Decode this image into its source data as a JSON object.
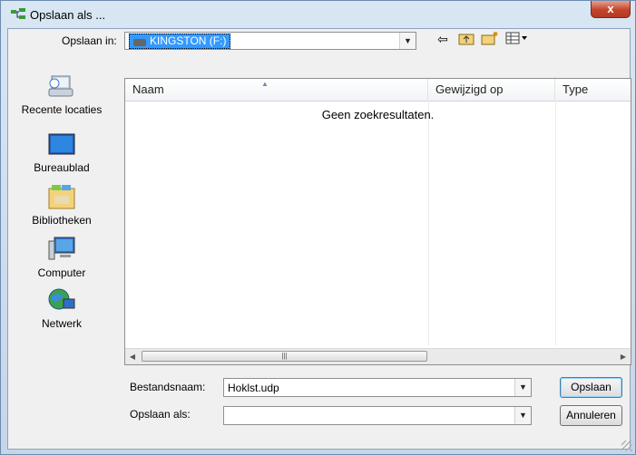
{
  "window": {
    "title": "Opslaan als ...",
    "close_glyph": "x"
  },
  "toolbar": {
    "save_in_label": "Opslaan in:",
    "location_value": "KINGSTON (F:)",
    "icons": [
      "back-icon",
      "up-folder-icon",
      "new-folder-icon",
      "view-menu-icon"
    ]
  },
  "places": [
    {
      "label": "Recente locaties",
      "icon": "recent-locations-icon"
    },
    {
      "label": "Bureaublad",
      "icon": "desktop-icon"
    },
    {
      "label": "Bibliotheken",
      "icon": "libraries-icon"
    },
    {
      "label": "Computer",
      "icon": "computer-icon"
    },
    {
      "label": "Netwerk",
      "icon": "network-icon"
    }
  ],
  "filelist": {
    "columns": [
      "Naam",
      "Gewijzigd op",
      "Type"
    ],
    "empty_message": "Geen zoekresultaten."
  },
  "form": {
    "filename_label": "Bestandsnaam:",
    "filename_value": "Hoklst.udp",
    "savetype_label": "Opslaan als:",
    "savetype_value": ""
  },
  "buttons": {
    "save": "Opslaan",
    "cancel": "Annuleren"
  }
}
